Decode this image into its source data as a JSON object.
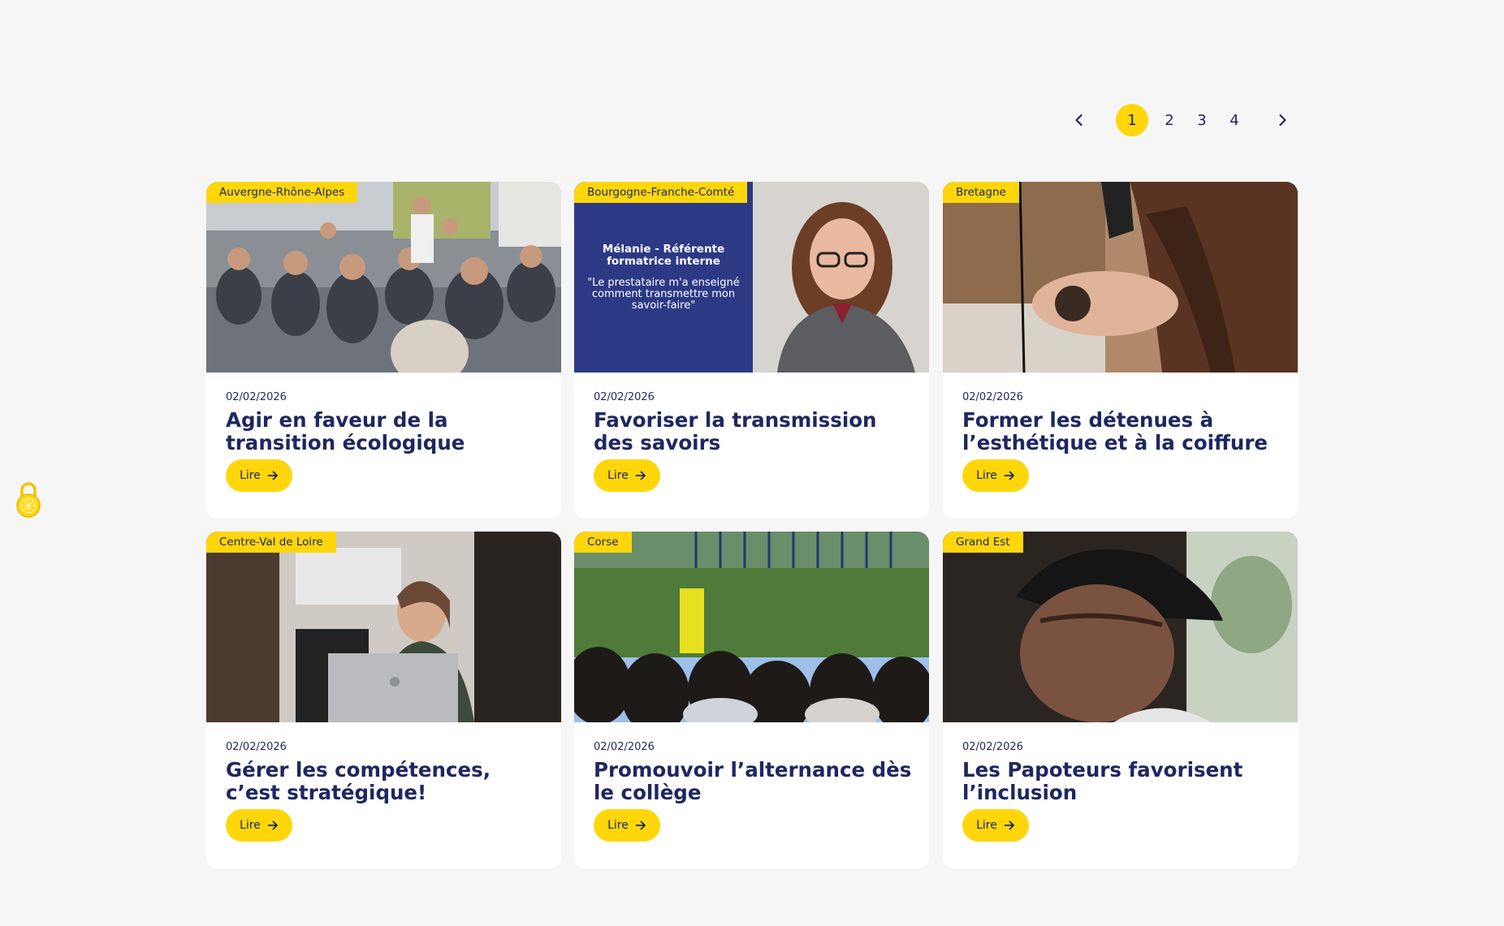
{
  "pagination": {
    "prev_icon": "chevron-left-icon",
    "next_icon": "chevron-right-icon",
    "pages": [
      "1",
      "2",
      "3",
      "4"
    ],
    "current": "1"
  },
  "colors": {
    "accent": "#ffd60a",
    "text": "#1e2760",
    "background": "#f6f6f6",
    "card": "#ffffff"
  },
  "cards": [
    {
      "region": "Auvergne-Rhône-Alpes",
      "date": "02/02/2026",
      "title": "Agir en faveur de la transition écologique",
      "button": "Lire"
    },
    {
      "region": "Bourgogne-Franche-Comté",
      "date": "02/02/2026",
      "title": "Favoriser la transmission des savoirs",
      "button": "Lire",
      "image_text": {
        "title": "Mélanie - Référente formatrice interne",
        "quote": "\"Le prestataire m'a enseigné comment transmettre mon savoir-faire\""
      }
    },
    {
      "region": "Bretagne",
      "date": "02/02/2026",
      "title": "Former les détenues à l’esthétique et à la coiffure",
      "button": "Lire"
    },
    {
      "region": "Centre-Val de Loire",
      "date": "02/02/2026",
      "title": "Gérer les compétences, c’est stratégique!",
      "button": "Lire"
    },
    {
      "region": "Corse",
      "date": "02/02/2026",
      "title": "Promouvoir l’alternance dès le collège",
      "button": "Lire"
    },
    {
      "region": "Grand Est",
      "date": "02/02/2026",
      "title": "Les Papoteurs favorisent l’inclusion",
      "button": "Lire"
    }
  ],
  "accessibility_widget": {
    "icon": "lock-icon"
  }
}
